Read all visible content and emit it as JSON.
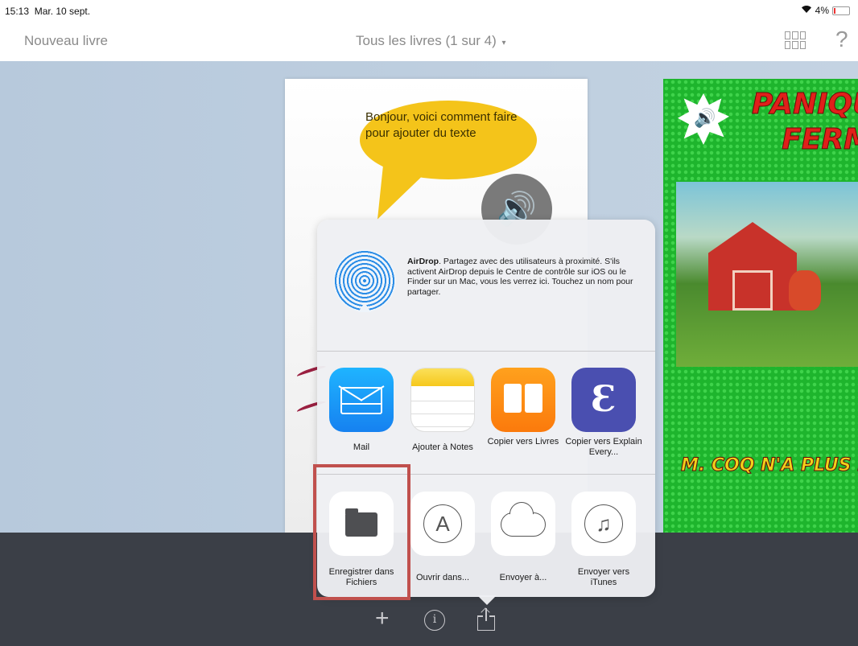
{
  "status": {
    "time": "15:13",
    "date": "Mar. 10 sept.",
    "battery": "4%"
  },
  "nav": {
    "new_book": "Nouveau livre",
    "title": "Tous les livres (1 sur 4)",
    "caret": "▾",
    "help": "?"
  },
  "page_left": {
    "bubble_text": "Bonjour, voici comment faire pour ajouter du texte"
  },
  "page_right": {
    "title_line1": "PANIQU",
    "title_line2": "FERM",
    "subtitle": "M. COQ N'A PLUS DE VO"
  },
  "share": {
    "airdrop": {
      "title": "AirDrop",
      "text": ". Partagez avec des utilisateurs à proximité. S'ils activent AirDrop depuis le Centre de contrôle sur iOS ou le Finder sur un Mac, vous les verrez ici. Touchez un nom pour partager."
    },
    "apps": [
      {
        "label": "Mail",
        "icon": "mail-icon"
      },
      {
        "label": "Ajouter à Notes",
        "icon": "notes-icon"
      },
      {
        "label": "Copier vers Livres",
        "icon": "books-icon"
      },
      {
        "label": "Copier vers Explain Every...",
        "icon": "explain-everything-icon"
      }
    ],
    "actions": [
      {
        "label": "Enregistrer dans Fichiers",
        "icon": "folder-icon"
      },
      {
        "label": "Ouvrir dans...",
        "icon": "app-store-icon"
      },
      {
        "label": "Envoyer à...",
        "icon": "cloud-icon"
      },
      {
        "label": "Envoyer vers iTunes",
        "icon": "music-note-icon"
      }
    ]
  },
  "toolbar": {
    "add": "+",
    "info": "i"
  },
  "colors": {
    "highlight": "#c0504d",
    "dark_bar": "#3b3f47",
    "accent_blue": "#1681f0"
  }
}
